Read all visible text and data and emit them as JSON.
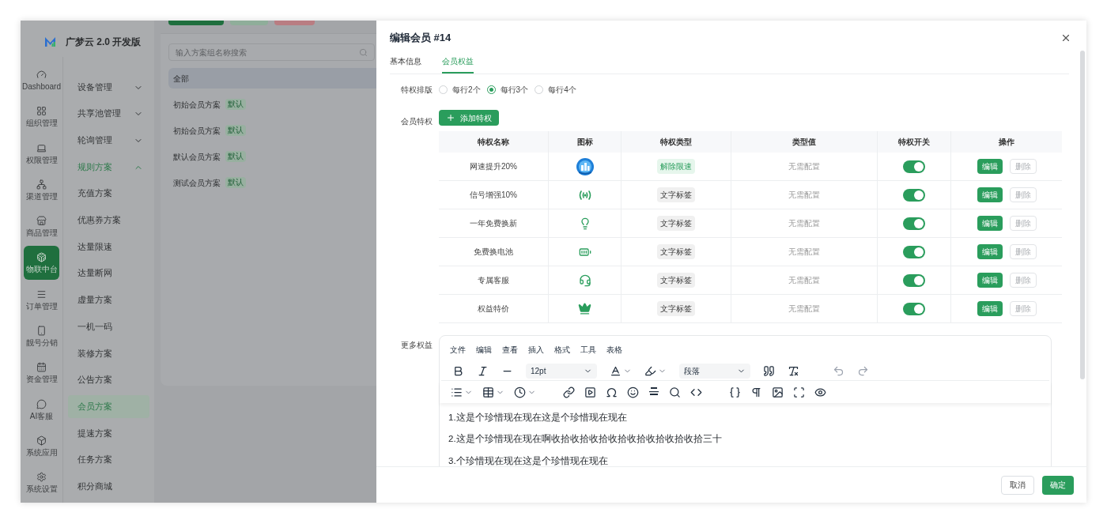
{
  "app": {
    "name": "广梦云 2.0 开发版"
  },
  "rail": [
    {
      "label": "Dashboard",
      "selected": false
    },
    {
      "label": "组织管理",
      "selected": false
    },
    {
      "label": "权限管理",
      "selected": false
    },
    {
      "label": "渠道管理",
      "selected": false
    },
    {
      "label": "商品管理",
      "selected": false
    },
    {
      "label": "物联中台",
      "selected": true
    },
    {
      "label": "订单管理",
      "selected": false
    },
    {
      "label": "靓号分销",
      "selected": false
    },
    {
      "label": "资金管理",
      "selected": false
    },
    {
      "label": "AI客服",
      "selected": false
    },
    {
      "label": "系统应用",
      "selected": false
    },
    {
      "label": "系统设置",
      "selected": false
    }
  ],
  "submenu": [
    {
      "label": "设备管理",
      "kind": "group",
      "expanded": false,
      "selected": false
    },
    {
      "label": "共享池管理",
      "kind": "group",
      "expanded": false,
      "selected": false
    },
    {
      "label": "轮询管理",
      "kind": "group",
      "expanded": false,
      "selected": false
    },
    {
      "label": "规则方案",
      "kind": "group",
      "expanded": true,
      "selected": true
    },
    {
      "label": "充值方案",
      "kind": "item",
      "selected": false
    },
    {
      "label": "优惠券方案",
      "kind": "item",
      "selected": false
    },
    {
      "label": "达量限速",
      "kind": "item",
      "selected": false
    },
    {
      "label": "达量断网",
      "kind": "item",
      "selected": false
    },
    {
      "label": "虚量方案",
      "kind": "item",
      "selected": false
    },
    {
      "label": "一机一码",
      "kind": "item",
      "selected": false
    },
    {
      "label": "装修方案",
      "kind": "item",
      "selected": false
    },
    {
      "label": "公告方案",
      "kind": "item",
      "selected": false
    },
    {
      "label": "会员方案",
      "kind": "item",
      "selected": true
    },
    {
      "label": "提速方案",
      "kind": "item",
      "selected": false
    },
    {
      "label": "任务方案",
      "kind": "item",
      "selected": false
    },
    {
      "label": "积分商城",
      "kind": "item",
      "selected": false
    }
  ],
  "plans": {
    "search": {
      "placeholder": "输入方案组名称搜索"
    },
    "items": [
      {
        "label": "全部",
        "selected": true
      },
      {
        "label": "初始会员方案",
        "badge": "默认",
        "selected": false
      },
      {
        "label": "初始会员方案",
        "badge": "默认",
        "selected": false
      },
      {
        "label": "默认会员方案",
        "badge": "默认",
        "selected": false
      },
      {
        "label": "测试会员方案",
        "badge": "默认",
        "selected": false
      }
    ]
  },
  "drawer": {
    "title": "编辑会员 #14",
    "tabs": [
      {
        "label": "基本信息",
        "selected": false
      },
      {
        "label": "会员权益",
        "selected": true
      }
    ],
    "layout": {
      "label": "特权排版",
      "options": [
        {
          "label": "每行2个",
          "selected": false
        },
        {
          "label": "每行3个",
          "selected": true
        },
        {
          "label": "每行4个",
          "selected": false
        }
      ]
    },
    "privileges": {
      "label": "会员特权",
      "add_button": "添加特权",
      "columns": [
        "特权名称",
        "图标",
        "特权类型",
        "类型值",
        "特权开关",
        "操作"
      ],
      "rows": [
        {
          "name": "网速提升20%",
          "type": {
            "label": "解除限速",
            "kind": "highlight"
          },
          "value": "无需配置",
          "on": true,
          "edit": "编辑",
          "delete": "删除"
        },
        {
          "name": "信号增强10%",
          "type": {
            "label": "文字标签",
            "kind": "plain"
          },
          "value": "无需配置",
          "on": true,
          "edit": "编辑",
          "delete": "删除"
        },
        {
          "name": "一年免费换新",
          "type": {
            "label": "文字标签",
            "kind": "plain"
          },
          "value": "无需配置",
          "on": true,
          "edit": "编辑",
          "delete": "删除"
        },
        {
          "name": "免费换电池",
          "type": {
            "label": "文字标签",
            "kind": "plain"
          },
          "value": "无需配置",
          "on": true,
          "edit": "编辑",
          "delete": "删除"
        },
        {
          "name": "专属客服",
          "type": {
            "label": "文字标签",
            "kind": "plain"
          },
          "value": "无需配置",
          "on": true,
          "edit": "编辑",
          "delete": "删除"
        },
        {
          "name": "权益特价",
          "type": {
            "label": "文字标签",
            "kind": "plain"
          },
          "value": "无需配置",
          "on": true,
          "edit": "编辑",
          "delete": "删除"
        }
      ]
    },
    "more": {
      "label": "更多权益",
      "menu": [
        "文件",
        "编辑",
        "查看",
        "插入",
        "格式",
        "工具",
        "表格"
      ],
      "font_size": "12pt",
      "block_format": "段落",
      "paragraphs": [
        "1.这是个珍惜现在现在这是个珍惜现在现在",
        "2.这是个珍惜现在现在啊收拾收拾收拾收拾收拾收拾收拾收拾三十",
        "3.个珍惜现在现在这是个珍惜现在现在"
      ]
    },
    "footer": {
      "cancel": "取消",
      "confirm": "确定"
    }
  }
}
